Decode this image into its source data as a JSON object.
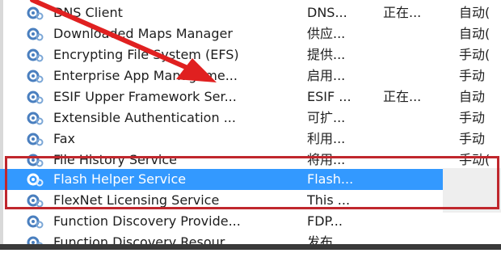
{
  "services": [
    {
      "name": "DNS Client",
      "description": "DNS...",
      "status": "正在...",
      "startup": "自动(",
      "selected": false
    },
    {
      "name": "Downloaded Maps Manager",
      "description": "供应...",
      "status": "",
      "startup": "自动(",
      "selected": false
    },
    {
      "name": "Encrypting File System (EFS)",
      "description": "提供...",
      "status": "",
      "startup": "手动(",
      "selected": false
    },
    {
      "name": "Enterprise App Manageme...",
      "description": "启用...",
      "status": "",
      "startup": "手动",
      "selected": false
    },
    {
      "name": "ESIF Upper Framework Ser...",
      "description": "ESIF ...",
      "status": "正在...",
      "startup": "自动",
      "selected": false
    },
    {
      "name": "Extensible Authentication ...",
      "description": "可扩...",
      "status": "",
      "startup": "手动",
      "selected": false
    },
    {
      "name": "Fax",
      "description": "利用...",
      "status": "",
      "startup": "手动",
      "selected": false
    },
    {
      "name": "File History Service",
      "description": "将用...",
      "status": "",
      "startup": "手动(",
      "selected": false
    },
    {
      "name": "Flash Helper Service",
      "description": "Flash...",
      "status": "",
      "startup": "",
      "selected": true
    },
    {
      "name": "FlexNet Licensing Service",
      "description": "This ...",
      "status": "",
      "startup": "",
      "selected": false
    },
    {
      "name": "Function Discovery Provide...",
      "description": "FDP...",
      "status": "",
      "startup": "",
      "selected": false
    },
    {
      "name": "Function Discovery Resour...",
      "description": "发布...",
      "status": "",
      "startup": "",
      "selected": false
    }
  ],
  "icons": {
    "service": "gear-service-icon",
    "arrow": "red-arrow-icon"
  },
  "colors": {
    "selection": "#3399ff",
    "highlight_box": "#c0272d",
    "arrow": "#e02020",
    "icon_blue": "#4a7fbf"
  }
}
